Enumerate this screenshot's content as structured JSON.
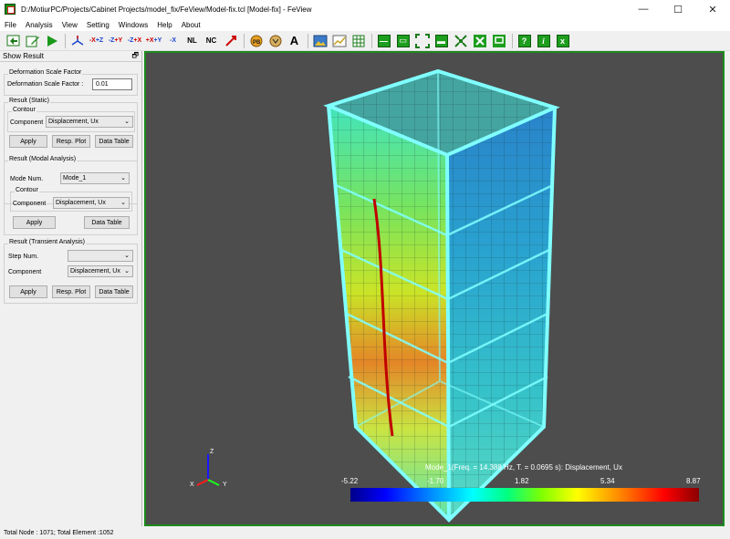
{
  "window": {
    "title": "D:/MotiurPC/Projects/Cabinet Projects/model_fix/FeView/Model-fix.tcl [Model-fix] - FeView",
    "minimize": "—",
    "maximize": "☐",
    "close": "✕"
  },
  "menu": [
    "File",
    "Analysis",
    "View",
    "Setting",
    "Windows",
    "Help",
    "About"
  ],
  "toolbar": {
    "view_labels": [
      "-X",
      "+Z",
      "-Z",
      "+Y",
      "-Z",
      "+X",
      "+X",
      "+Y",
      "-X"
    ],
    "nl_label": "NL",
    "nc_label": "NC",
    "a_label": "A",
    "q_label": "?",
    "i_label": "i",
    "x_label": "x"
  },
  "panel": {
    "title": "Show Result",
    "deformation": {
      "group_title": "Deformation Scale Factor",
      "label": "Deformation Scale Factor :",
      "value": "0.01"
    },
    "static": {
      "group_title": "Result (Static)",
      "sub_title": "Contour",
      "component_label": "Component",
      "component_value": "Displacement, Ux",
      "apply": "Apply",
      "resp_plot": "Resp. Plot",
      "data_table": "Data Table"
    },
    "modal": {
      "group_title": "Result (Modal Analysis)",
      "mode_label": "Mode Num.",
      "mode_value": "Mode_1",
      "sub_title": "Contour",
      "component_label": "Component",
      "component_value": "Displacement, Ux",
      "apply": "Apply",
      "data_table": "Data Table"
    },
    "transient": {
      "group_title": "Result (Transient Analysis)",
      "step_label": "Step Num.",
      "step_value": "",
      "component_label": "Component",
      "component_value": "Displacement, Ux",
      "apply": "Apply",
      "resp_plot": "Resp. Plot",
      "data_table": "Data Table"
    }
  },
  "viewport": {
    "legend_title": "Mode_1(Freq. = 14.388 Hz, T. = 0.0695 s): Displacement, Ux",
    "legend_ticks": [
      "-5.22",
      "-1.70",
      "1.82",
      "5.34",
      "8.87"
    ],
    "axes": {
      "x": "X",
      "y": "Y",
      "z": "Z"
    }
  },
  "status": "Total Node : 1071; Total Element :1052"
}
